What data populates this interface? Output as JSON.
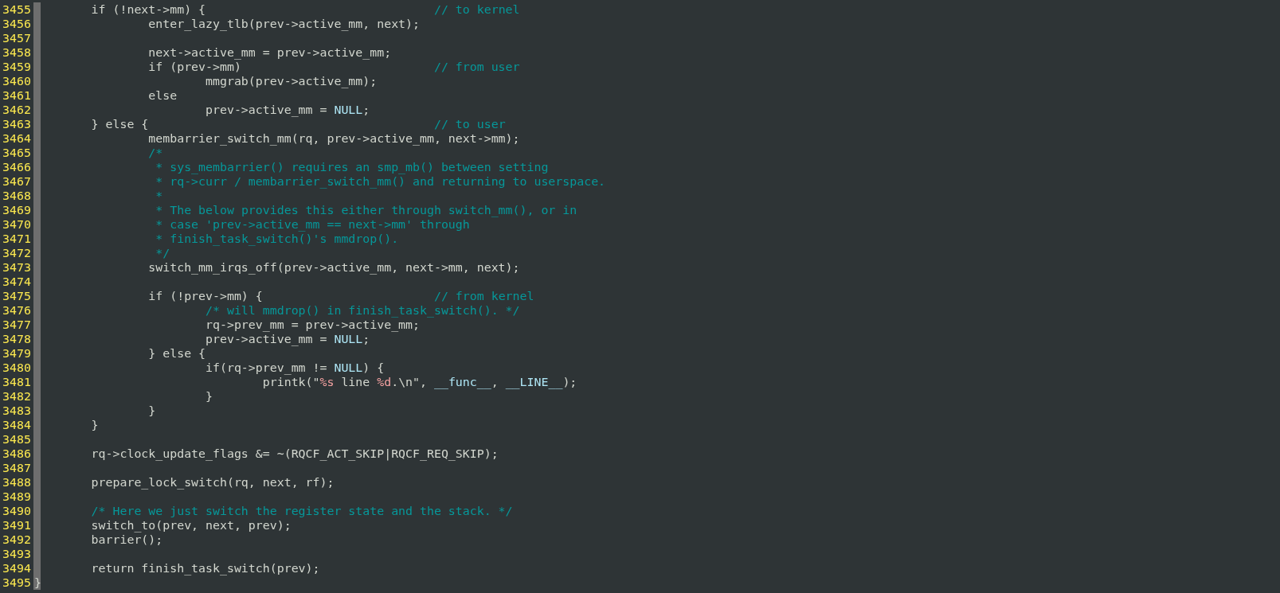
{
  "editor": {
    "lines": [
      {
        "number": "3455",
        "code": [
          {
            "kind": "plain",
            "text": "\tif (!next->mm) {"
          }
        ],
        "comment": "// to kernel"
      },
      {
        "number": "3456",
        "code": [
          {
            "kind": "plain",
            "text": "\t\tenter_lazy_tlb(prev->active_mm, next);"
          }
        ]
      },
      {
        "number": "3457"
      },
      {
        "number": "3458",
        "code": [
          {
            "kind": "plain",
            "text": "\t\tnext->active_mm = prev->active_mm;"
          }
        ]
      },
      {
        "number": "3459",
        "code": [
          {
            "kind": "plain",
            "text": "\t\tif (prev->mm)"
          }
        ],
        "comment": "// from user"
      },
      {
        "number": "3460",
        "code": [
          {
            "kind": "plain",
            "text": "\t\t\tmmgrab(prev->active_mm);"
          }
        ]
      },
      {
        "number": "3461",
        "code": [
          {
            "kind": "plain",
            "text": "\t\telse"
          }
        ]
      },
      {
        "number": "3462",
        "code": [
          {
            "kind": "plain",
            "text": "\t\t\tprev->active_mm = "
          },
          {
            "kind": "constant",
            "text": "NULL"
          },
          {
            "kind": "plain",
            "text": ";"
          }
        ]
      },
      {
        "number": "3463",
        "code": [
          {
            "kind": "plain",
            "text": "\t} else {"
          }
        ],
        "comment": "// to user"
      },
      {
        "number": "3464",
        "code": [
          {
            "kind": "plain",
            "text": "\t\tmembarrier_switch_mm(rq, prev->active_mm, next->mm);"
          }
        ]
      },
      {
        "number": "3465",
        "code": [
          {
            "kind": "comment",
            "text": "\t\t/*"
          }
        ]
      },
      {
        "number": "3466",
        "code": [
          {
            "kind": "comment",
            "text": "\t\t * sys_membarrier() requires an smp_mb() between setting"
          }
        ]
      },
      {
        "number": "3467",
        "code": [
          {
            "kind": "comment",
            "text": "\t\t * rq->curr / membarrier_switch_mm() and returning to userspace."
          }
        ]
      },
      {
        "number": "3468",
        "code": [
          {
            "kind": "comment",
            "text": "\t\t *"
          }
        ]
      },
      {
        "number": "3469",
        "code": [
          {
            "kind": "comment",
            "text": "\t\t * The below provides this either through switch_mm(), or in"
          }
        ]
      },
      {
        "number": "3470",
        "code": [
          {
            "kind": "comment",
            "text": "\t\t * case 'prev->active_mm == next->mm' through"
          }
        ]
      },
      {
        "number": "3471",
        "code": [
          {
            "kind": "comment",
            "text": "\t\t * finish_task_switch()'s mmdrop()."
          }
        ]
      },
      {
        "number": "3472",
        "code": [
          {
            "kind": "comment",
            "text": "\t\t */"
          }
        ]
      },
      {
        "number": "3473",
        "code": [
          {
            "kind": "plain",
            "text": "\t\tswitch_mm_irqs_off(prev->active_mm, next->mm, next);"
          }
        ]
      },
      {
        "number": "3474"
      },
      {
        "number": "3475",
        "code": [
          {
            "kind": "plain",
            "text": "\t\tif (!prev->mm) {"
          }
        ],
        "comment": "// from kernel"
      },
      {
        "number": "3476",
        "code": [
          {
            "kind": "comment",
            "text": "\t\t\t/* will mmdrop() in finish_task_switch(). */"
          }
        ]
      },
      {
        "number": "3477",
        "code": [
          {
            "kind": "plain",
            "text": "\t\t\trq->prev_mm = prev->active_mm;"
          }
        ]
      },
      {
        "number": "3478",
        "code": [
          {
            "kind": "plain",
            "text": "\t\t\tprev->active_mm = "
          },
          {
            "kind": "constant",
            "text": "NULL"
          },
          {
            "kind": "plain",
            "text": ";"
          }
        ]
      },
      {
        "number": "3479",
        "code": [
          {
            "kind": "plain",
            "text": "\t\t} else {"
          }
        ]
      },
      {
        "number": "3480",
        "code": [
          {
            "kind": "plain",
            "text": "\t\t\tif(rq->prev_mm != "
          },
          {
            "kind": "constant",
            "text": "NULL"
          },
          {
            "kind": "plain",
            "text": ") {"
          }
        ]
      },
      {
        "number": "3481",
        "code": [
          {
            "kind": "plain",
            "text": "\t\t\t\tprintk(\""
          },
          {
            "kind": "special",
            "text": "%s"
          },
          {
            "kind": "plain",
            "text": " line "
          },
          {
            "kind": "special",
            "text": "%d"
          },
          {
            "kind": "plain",
            "text": ".\\n\", "
          },
          {
            "kind": "constant",
            "text": "__func__"
          },
          {
            "kind": "plain",
            "text": ", "
          },
          {
            "kind": "constant",
            "text": "__LINE__"
          },
          {
            "kind": "plain",
            "text": ");"
          }
        ]
      },
      {
        "number": "3482",
        "code": [
          {
            "kind": "plain",
            "text": "\t\t\t}"
          }
        ]
      },
      {
        "number": "3483",
        "code": [
          {
            "kind": "plain",
            "text": "\t\t}"
          }
        ]
      },
      {
        "number": "3484",
        "code": [
          {
            "kind": "plain",
            "text": "\t}"
          }
        ]
      },
      {
        "number": "3485"
      },
      {
        "number": "3486",
        "code": [
          {
            "kind": "plain",
            "text": "\trq->clock_update_flags &= ~(RQCF_ACT_SKIP|RQCF_REQ_SKIP);"
          }
        ]
      },
      {
        "number": "3487"
      },
      {
        "number": "3488",
        "code": [
          {
            "kind": "plain",
            "text": "\tprepare_lock_switch(rq, next, rf);"
          }
        ]
      },
      {
        "number": "3489"
      },
      {
        "number": "3490",
        "code": [
          {
            "kind": "comment",
            "text": "\t/* Here we just switch the register state and the stack. */"
          }
        ]
      },
      {
        "number": "3491",
        "code": [
          {
            "kind": "plain",
            "text": "\tswitch_to(prev, next, prev);"
          }
        ]
      },
      {
        "number": "3492",
        "code": [
          {
            "kind": "plain",
            "text": "\tbarrier();"
          }
        ]
      },
      {
        "number": "3493"
      },
      {
        "number": "3494",
        "code": [
          {
            "kind": "plain",
            "text": "\treturn finish_task_switch(prev);"
          }
        ]
      },
      {
        "number": "3495",
        "code": [
          {
            "kind": "plain",
            "text": "}"
          }
        ]
      }
    ]
  }
}
